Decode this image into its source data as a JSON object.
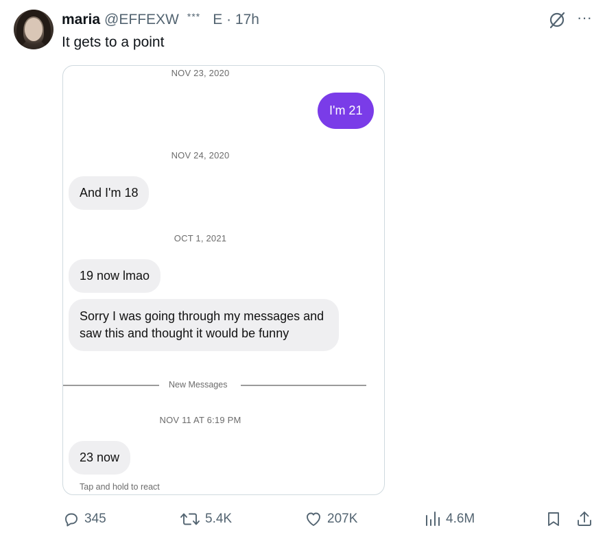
{
  "tweet": {
    "display_name": "maria",
    "handle": "@EFFEXW",
    "badge": "***",
    "meta": "E · 17h",
    "text": "It gets to a point",
    "avatar_icon": "avatar-photo",
    "grok_icon": "slashed-circle-icon",
    "more_label": "···"
  },
  "chat": {
    "messages_section": [
      {
        "date": "NOV 23, 2020"
      },
      {
        "date": "NOV 24, 2020"
      },
      {
        "date": "OCT 1, 2021"
      },
      {
        "date": "NOV 11 AT 6:19 PM"
      }
    ],
    "bubble_out_1": "I'm 21",
    "bubble_in_1": "And I'm 18",
    "bubble_in_2": "19 now lmao",
    "bubble_in_3": "Sorry I was going through my messages and saw this and thought it would be funny",
    "new_messages_label": "New Messages",
    "bubble_in_4": "23 now",
    "tap_hint": "Tap and hold to react",
    "colors": {
      "outgoing_bubble": "#7a3ce8",
      "incoming_bubble": "#efeff1"
    }
  },
  "actions": {
    "replies": "345",
    "reposts": "5.4K",
    "likes": "207K",
    "views": "4.6M",
    "icons": [
      "reply-icon",
      "repost-icon",
      "like-icon",
      "views-icon",
      "bookmark-icon",
      "share-icon"
    ]
  }
}
